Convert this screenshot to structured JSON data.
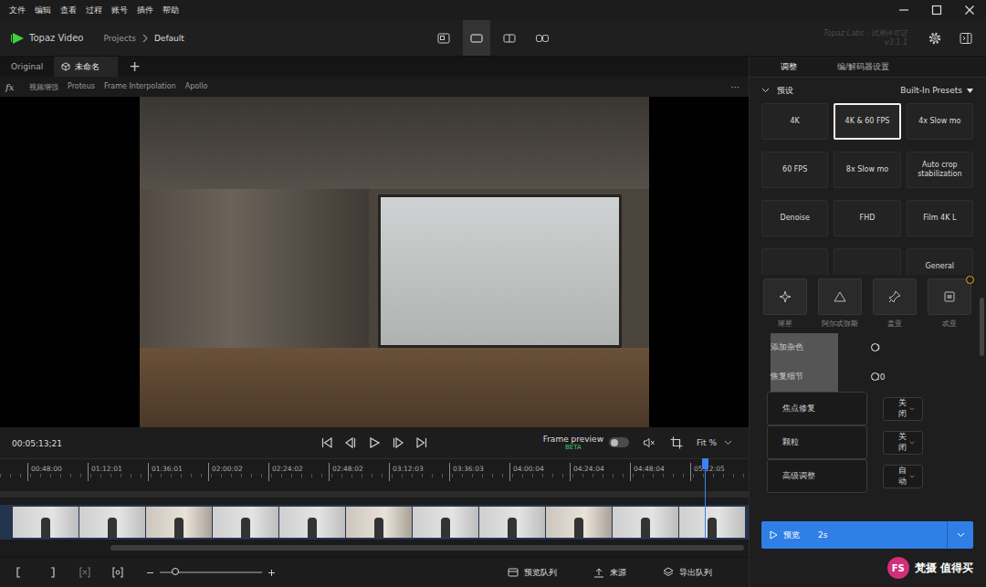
{
  "menu": [
    "文件",
    "编辑",
    "查看",
    "过程",
    "账号",
    "插件",
    "帮助"
  ],
  "app": {
    "name": "Topaz Video",
    "breadcrumb": [
      "Projects",
      "Default"
    ],
    "license": "Topaz Labs - 试用许可证",
    "version": "v3.1.1"
  },
  "view_modes": [
    {
      "kind": "compare",
      "selected": false
    },
    {
      "kind": "single",
      "selected": true
    },
    {
      "kind": "side",
      "selected": false
    },
    {
      "kind": "split",
      "selected": false
    }
  ],
  "tabs": [
    {
      "label": "Original",
      "selected": false
    },
    {
      "label": "未命名",
      "selected": true
    }
  ],
  "add_tab": "+",
  "pipeline": {
    "icon": "fx",
    "items": [
      "视频增强",
      "Proteus",
      "Frame Interpolation",
      "Apollo"
    ],
    "more": "···"
  },
  "player": {
    "timecode": "00:05:13;21",
    "frame_preview": {
      "label": "Frame preview",
      "badge": "BETA",
      "on": false
    },
    "zoom": "Fit %"
  },
  "timeline": {
    "ticks": [
      "00:48:00",
      "01:12:01",
      "01:36:01",
      "02:00:02",
      "02:24:02",
      "02:48:02",
      "03:12:03",
      "03:36:03",
      "04:00:04",
      "04:24:04",
      "04:48:04",
      "05:12:05"
    ],
    "playhead": 0.942,
    "scrollbar": {
      "start": 0.148,
      "size": 0.846
    }
  },
  "bottom_bar": {
    "zoom_level": 0.15,
    "buttons": [
      "预览队列",
      "来源",
      "导出队列"
    ]
  },
  "panel": {
    "tabs": [
      {
        "label": "调整",
        "selected": true
      },
      {
        "label": "编/解码器设置",
        "selected": false
      }
    ],
    "presets": {
      "title": "预设",
      "expanded": true,
      "source": "Built-In Presets",
      "items": [
        {
          "label": "4K",
          "selected": false
        },
        {
          "label": "4K & 60 FPS",
          "selected": true
        },
        {
          "label": "4x Slow mo",
          "selected": false
        },
        {
          "label": "60 FPS",
          "selected": false
        },
        {
          "label": "8x Slow mo",
          "selected": false
        },
        {
          "label": "Auto crop stabilization",
          "selected": false
        },
        {
          "label": "Denoise",
          "selected": false
        },
        {
          "label": "FHD",
          "selected": false
        },
        {
          "label": "Film 4K L",
          "selected": false
        },
        {
          "label": "",
          "selected": false
        },
        {
          "label": "",
          "selected": false
        },
        {
          "label": "General",
          "selected": false
        }
      ]
    },
    "models": [
      {
        "label": "璀星",
        "kind": "sparkle",
        "badge": false
      },
      {
        "label": "阿尔忒弥斯",
        "kind": "triangle",
        "badge": false
      },
      {
        "label": "盖亚",
        "kind": "pin",
        "badge": false
      },
      {
        "label": "忒亚",
        "kind": "image",
        "badge": true
      }
    ],
    "settings": [
      {
        "kind": "slider",
        "label": "添加杂色",
        "level": 0,
        "value": "0"
      },
      {
        "kind": "slider",
        "label": "恢复细节",
        "level": 0.2,
        "value": "20"
      },
      {
        "kind": "select",
        "label": "焦点修复",
        "value": "关闭"
      },
      {
        "kind": "select",
        "label": "颗粒",
        "value": "关闭"
      },
      {
        "kind": "select",
        "label": "高级调整",
        "value": "自动"
      }
    ],
    "scroll": 0.45,
    "preview_button": {
      "label": "预览",
      "duration": "2s"
    }
  },
  "watermark": {
    "logo": "FS",
    "text": "梵摄 值得买"
  }
}
